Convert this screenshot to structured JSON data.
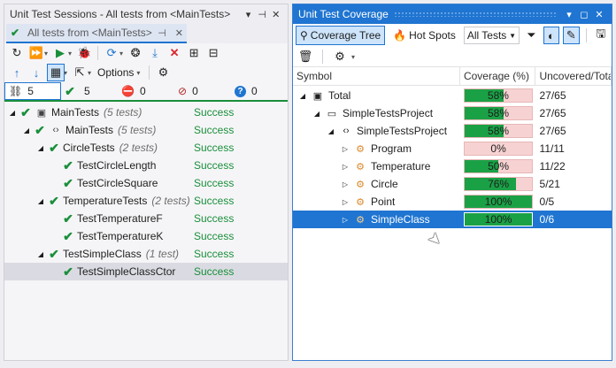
{
  "left": {
    "title": "Unit Test Sessions - All tests from <MainTests>",
    "tab_label": "All tests from <MainTests>",
    "options_label": "Options",
    "counts": [
      {
        "icon": "link-icon",
        "value": "5"
      },
      {
        "icon": "check-icon",
        "value": "5"
      },
      {
        "icon": "failed-icon",
        "value": "0"
      },
      {
        "icon": "ignored-icon",
        "value": "0"
      },
      {
        "icon": "unknown-icon",
        "value": "0"
      }
    ],
    "tree": [
      {
        "name": "MainTests",
        "count": "(5 tests)",
        "status": "Success"
      },
      {
        "name": "MainTests",
        "count": "(5 tests)",
        "status": "Success"
      },
      {
        "name": "CircleTests",
        "count": "(2 tests)",
        "status": "Success"
      },
      {
        "name": "TestCircleLength",
        "count": "",
        "status": "Success"
      },
      {
        "name": "TestCircleSquare",
        "count": "",
        "status": "Success"
      },
      {
        "name": "TemperatureTests",
        "count": "(2 tests)",
        "status": "Success"
      },
      {
        "name": "TestTemperatureF",
        "count": "",
        "status": "Success"
      },
      {
        "name": "TestTemperatureK",
        "count": "",
        "status": "Success"
      },
      {
        "name": "TestSimpleClass",
        "count": "(1 test)",
        "status": "Success"
      },
      {
        "name": "TestSimpleClassCtor",
        "count": "",
        "status": "Success"
      }
    ]
  },
  "right": {
    "title": "Unit Test Coverage",
    "coverage_tree_label": "Coverage Tree",
    "hot_spots_label": "Hot Spots",
    "filter_value": "All Tests",
    "columns": [
      "Symbol",
      "Coverage (%)",
      "Uncovered/Tota"
    ],
    "rows": [
      {
        "name": "Total",
        "coverage": 58,
        "pct_label": "58%",
        "uncovered": "27/65"
      },
      {
        "name": "SimpleTestsProject",
        "coverage": 58,
        "pct_label": "58%",
        "uncovered": "27/65"
      },
      {
        "name": "SimpleTestsProject",
        "coverage": 58,
        "pct_label": "58%",
        "uncovered": "27/65"
      },
      {
        "name": "Program",
        "coverage": 0,
        "pct_label": "0%",
        "uncovered": "11/11"
      },
      {
        "name": "Temperature",
        "coverage": 50,
        "pct_label": "50%",
        "uncovered": "11/22"
      },
      {
        "name": "Circle",
        "coverage": 76,
        "pct_label": "76%",
        "uncovered": "5/21"
      },
      {
        "name": "Point",
        "coverage": 100,
        "pct_label": "100%",
        "uncovered": "0/5"
      },
      {
        "name": "SimpleClass",
        "coverage": 100,
        "pct_label": "100%",
        "uncovered": "0/6"
      }
    ]
  },
  "colors": {
    "success": "#1a8f3b",
    "accent": "#1f75d1",
    "uncovered": "#f7d2d2",
    "covered": "#1aa146"
  }
}
